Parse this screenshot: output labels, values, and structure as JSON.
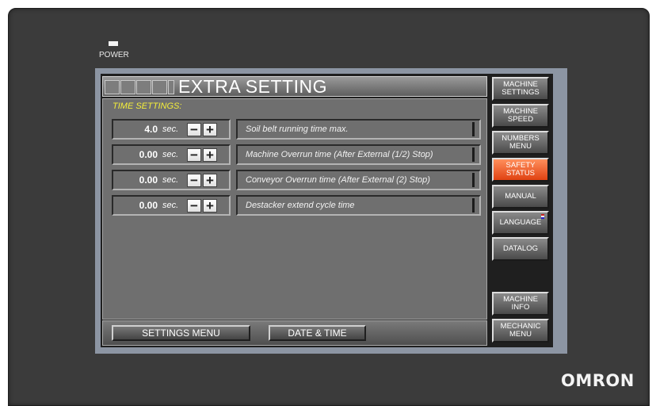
{
  "device": {
    "power_label": "POWER",
    "brand": "OMRON"
  },
  "screen": {
    "title": "EXTRA SETTING",
    "section_title": "TIME SETTINGS:",
    "settings": [
      {
        "value": "4.0",
        "unit": "sec.",
        "description": "Soil belt running time max."
      },
      {
        "value": "0.00",
        "unit": "sec.",
        "description": "Machine Overrun time (After External (1/2) Stop)"
      },
      {
        "value": "0.00",
        "unit": "sec.",
        "description": "Conveyor Overrun time (After External (2) Stop)"
      },
      {
        "value": "0.00",
        "unit": "sec.",
        "description": "Destacker extend cycle time"
      }
    ],
    "bottom": {
      "settings_menu": "SETTINGS MENU",
      "date_time": "DATE & TIME"
    },
    "side_menu": {
      "machine_settings": "MACHINE\nSETTINGS",
      "machine_speed": "MACHINE\nSPEED",
      "numbers_menu": "NUMBERS\nMENU",
      "safety_status": "SAFETY\nSTATUS",
      "manual": "MANUAL",
      "language": "LANGUAGE",
      "datalog": "DATALOG",
      "machine_info": "MACHINE\nINFO",
      "mechanic_menu": "MECHANIC\nMENU"
    },
    "colors": {
      "accent_active": "#e85a22",
      "section_title": "#f5ef3a",
      "panel": "#6f6f6f"
    },
    "icons": {
      "decrement": "minus-icon",
      "increment": "plus-icon",
      "language_flag": "flag-icon"
    }
  }
}
